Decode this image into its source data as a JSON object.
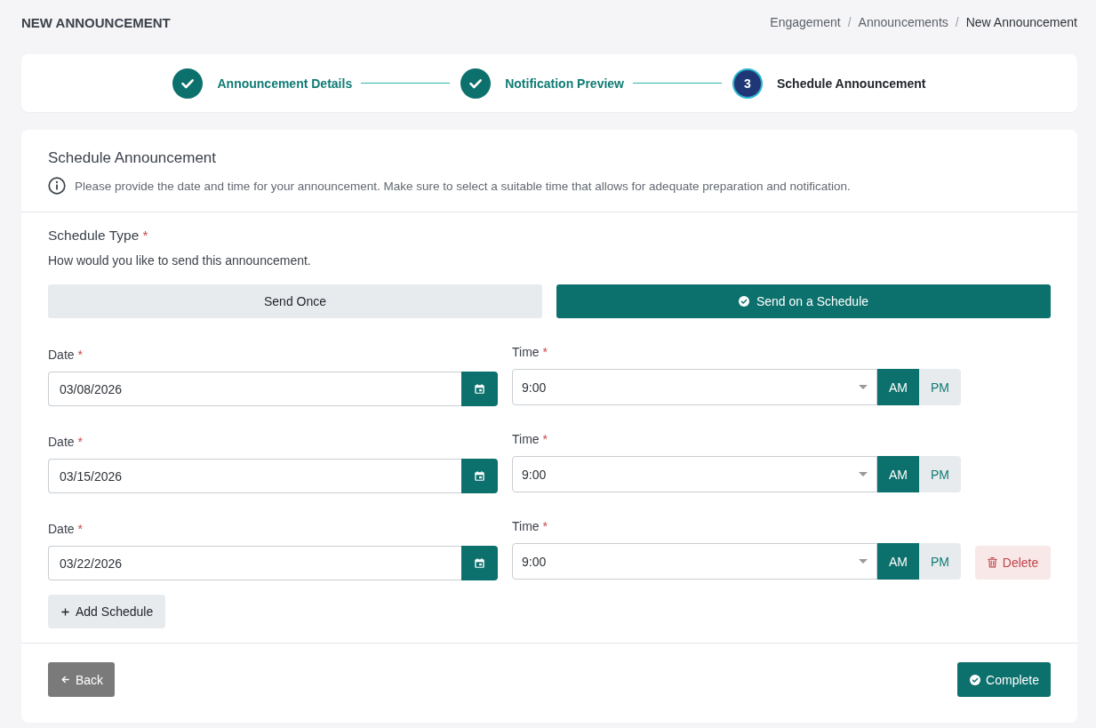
{
  "header": {
    "title": "NEW ANNOUNCEMENT",
    "breadcrumb": [
      {
        "label": "Engagement",
        "current": false
      },
      {
        "separator": "/",
        "label": "Announcements",
        "current": false
      },
      {
        "separator": "/",
        "label": "New Announcement",
        "current": true
      }
    ]
  },
  "stepper": {
    "steps": [
      {
        "label": "Announcement Details",
        "completed": true
      },
      {
        "label": "Notification Preview",
        "completed": true
      },
      {
        "label": "Schedule Announcement",
        "completed": false,
        "number": "3"
      }
    ]
  },
  "card": {
    "title": "Schedule Announcement",
    "info": "Please provide the date and time for your announcement. Make sure to select a suitable time that allows for adequate preparation and notification."
  },
  "schedule_type": {
    "label": "Schedule Type",
    "required_mark": "*",
    "hint": "How would you like to send this announcement.",
    "options": [
      {
        "label": "Send Once",
        "selected": false
      },
      {
        "label": "Send on a Schedule",
        "selected": true
      }
    ]
  },
  "schedules": [
    {
      "date_label": "Date",
      "date_required_mark": "*",
      "date": "03/08/2026",
      "time_label": "Time",
      "time_required_mark": "*",
      "time": "9:00",
      "periods": [
        {
          "label": "AM",
          "selected": true
        },
        {
          "label": "PM",
          "selected": false
        }
      ]
    },
    {
      "date_label": "Date",
      "date_required_mark": "*",
      "date": "03/15/2026",
      "time_label": "Time",
      "time_required_mark": "*",
      "time": "9:00",
      "periods": [
        {
          "label": "AM",
          "selected": true
        },
        {
          "label": "PM",
          "selected": false
        }
      ]
    },
    {
      "date_label": "Date",
      "date_required_mark": "*",
      "date": "03/22/2026",
      "time_label": "Time",
      "time_required_mark": "*",
      "time": "9:00",
      "periods": [
        {
          "label": "AM",
          "selected": true
        },
        {
          "label": "PM",
          "selected": false
        }
      ],
      "delete": "Delete"
    }
  ],
  "add_schedule": "Add Schedule",
  "footer": {
    "back": "Back",
    "complete": "Complete"
  }
}
